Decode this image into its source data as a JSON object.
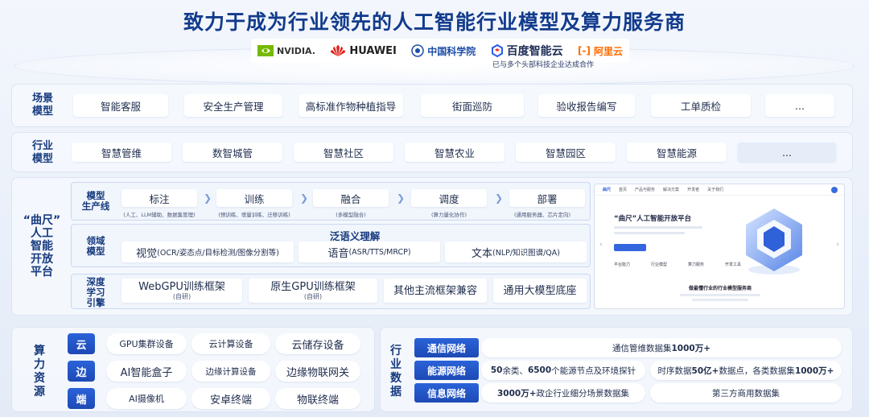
{
  "title": "致力于成为行业领先的人工智能行业模型及算力服务商",
  "partners": {
    "logos": [
      "NVIDIA.",
      "HUAWEI",
      "中国科学院",
      "百度智能云",
      "阿里云"
    ],
    "note": "已与多个头部科技企业达成合作"
  },
  "scenario": {
    "label_line1": "场景",
    "label_line2": "模型",
    "items": [
      "智能客服",
      "安全生产管理",
      "高标准作物种植指导",
      "街面巡防",
      "验收报告编写",
      "工单质检",
      "..."
    ]
  },
  "industry": {
    "label_line1": "行业",
    "label_line2": "模型",
    "items": [
      "智慧管维",
      "数智城管",
      "智慧社区",
      "智慧农业",
      "智慧园区",
      "智慧能源",
      "..."
    ]
  },
  "platform": {
    "label_line1": "“曲尺”",
    "label_line2": "人工",
    "label_line3": "智能",
    "label_line4": "开放",
    "label_line5": "平台",
    "pipeline": {
      "label_line1": "模型",
      "label_line2": "生产线",
      "steps": [
        {
          "name": "标注",
          "sub": "(人工、LLM辅助、数据集管理)"
        },
        {
          "name": "训练",
          "sub": "(预训练、增量训练、迁移训练)"
        },
        {
          "name": "融合",
          "sub": "(多模型融合)"
        },
        {
          "name": "调度",
          "sub": "(算力量化协作)"
        },
        {
          "name": "部署",
          "sub": "(通用服务器、芯片定向)"
        }
      ]
    },
    "domain": {
      "label_line1": "领域",
      "label_line2": "模型",
      "heading": "泛语义理解",
      "items": [
        {
          "name": "视觉",
          "detail": "(OCR/姿态点/目标检测/图像分割等)"
        },
        {
          "name": "语音",
          "detail": "(ASR/TTS/MRCP)"
        },
        {
          "name": "文本",
          "detail": "(NLP/知识图谱/QA)"
        }
      ]
    },
    "dl": {
      "label_line1": "深度",
      "label_line2": "学习",
      "label_line3": "引擎",
      "items": [
        {
          "name": "WebGPU训练框架",
          "sub": "(自研)"
        },
        {
          "name": "原生GPU训练框架",
          "sub": "(自研)"
        },
        {
          "name": "其他主流框架兼容",
          "sub": ""
        },
        {
          "name": "通用大模型底座",
          "sub": ""
        }
      ]
    },
    "screenshot": {
      "brand": "曲尺",
      "nav": [
        "首页",
        "产品与服务",
        "解决方案",
        "开发者",
        "关于我们"
      ],
      "heading": "“曲尺”人工智能开放平台",
      "cards": [
        "平台能力",
        "行业模型",
        "算力服务",
        "开发工具"
      ],
      "footer": "做最懂行业的行业模型服务商"
    }
  },
  "compute": {
    "label_line1": "算",
    "label_line2": "力",
    "label_line3": "资",
    "label_line4": "源",
    "rows": [
      {
        "tag": "云",
        "items": [
          "GPU集群设备",
          "云计算设备",
          "云储存设备"
        ]
      },
      {
        "tag": "边",
        "items": [
          "AI智能盒子",
          "边缘计算设备",
          "边缘物联网关"
        ]
      },
      {
        "tag": "端",
        "items": [
          "AI摄像机",
          "安卓终端",
          "物联终端"
        ]
      }
    ]
  },
  "data": {
    "label_line1": "行",
    "label_line2": "业",
    "label_line3": "数",
    "label_line4": "据",
    "rows": [
      {
        "tag": "通信网络",
        "items": [
          {
            "pre": "通信管维数据集 ",
            "bold": "1000万+",
            "post": ""
          }
        ]
      },
      {
        "tag": "能源网络",
        "items": [
          {
            "pre": "",
            "bold": "50",
            "post": "余类、",
            "bold2": "6500",
            "post2": "个能源节点及环境探针"
          },
          {
            "pre": "时序数据",
            "bold": "50亿+",
            "post": "数据点，各类数据集",
            "bold2": "1000万+",
            "post2": ""
          }
        ]
      },
      {
        "tag": "信息网络",
        "items": [
          {
            "pre": "",
            "bold": "3000万+",
            "post": "政企行业细分场景数据集"
          },
          {
            "pre": "第三方商用数据集",
            "bold": "",
            "post": ""
          }
        ]
      }
    ]
  },
  "colors": {
    "primary": "#1d49b5",
    "title": "#123b8c",
    "panel": "#f6f9fe"
  }
}
